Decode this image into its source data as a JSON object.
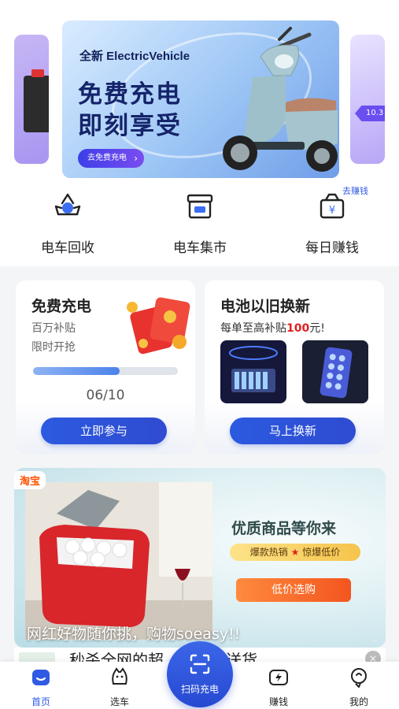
{
  "banner": {
    "brand": "全新 ElectricVehicle",
    "headline1": "免费充电",
    "headline2": "即刻享受",
    "cta": "去免费充电",
    "right_tag": "10.3"
  },
  "entries": [
    {
      "label": "电车回收",
      "icon": "recycle-icon"
    },
    {
      "label": "电车集市",
      "icon": "market-stall-icon"
    },
    {
      "label": "每日赚钱",
      "icon": "money-bag-icon"
    }
  ],
  "earn_tag": "去赚钱",
  "charge_card": {
    "title": "免费充电",
    "line1": "百万补贴",
    "line2": "限时开抢",
    "progress_text": "06/10",
    "progress_value": 0.6,
    "button": "立即参与"
  },
  "battery_card": {
    "title": "电池以旧换新",
    "subtitle_prefix": "每单至高补贴",
    "subtitle_amount": "100",
    "subtitle_suffix": "元!",
    "button": "马上换新"
  },
  "ad": {
    "source": "淘宝",
    "headline": "优质商品等你来",
    "pill_left": "爆款热销",
    "pill_right": "惊爆低价",
    "buy_button": "低价选购",
    "overlay": "网红好物随你挑，购物soeasy!!",
    "disclaimer": "..."
  },
  "ad_strip": {
    "text": "秒杀全网的超...电般的送货",
    "close": "×"
  },
  "tabbar": {
    "home": "首页",
    "choose": "选车",
    "scan": "扫码充电",
    "earn": "赚钱",
    "mine": "我的"
  },
  "colors": {
    "accent": "#2f5ae3",
    "price_red": "#e02020",
    "buy_orange": "#f3551f"
  }
}
